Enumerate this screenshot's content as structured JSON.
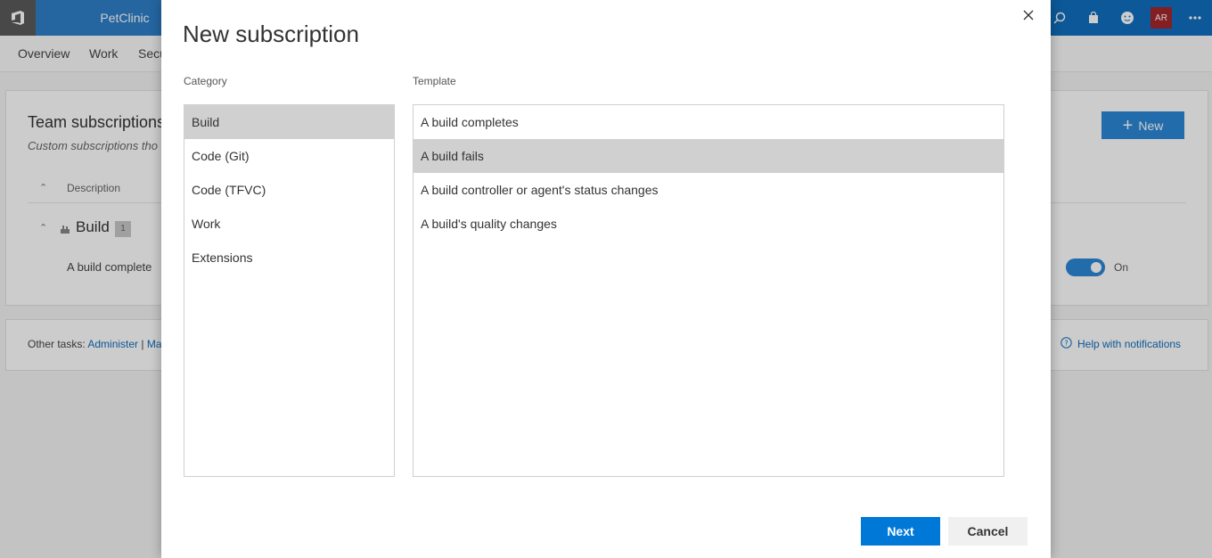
{
  "header": {
    "project": "PetClinic",
    "avatar_initials": "AR"
  },
  "subnav": {
    "items": [
      "Overview",
      "Work",
      "Secu"
    ]
  },
  "page": {
    "team_title": "Team subscriptions",
    "team_subtitle": "Custom subscriptions tho",
    "description_header": "Description",
    "group_name": "Build",
    "group_count": "1",
    "row_text": "A build complete",
    "new_button": "New",
    "toggle_label": "On",
    "other_tasks_label": "Other tasks:",
    "other_tasks_link1": "Administer",
    "other_tasks_sep": "|",
    "other_tasks_link2": "Ma",
    "help_link": "Help with notifications"
  },
  "dialog": {
    "title": "New subscription",
    "category_label": "Category",
    "template_label": "Template",
    "categories": [
      "Build",
      "Code (Git)",
      "Code (TFVC)",
      "Work",
      "Extensions"
    ],
    "templates": [
      "A build completes",
      "A build fails",
      "A build controller or agent's status changes",
      "A build's quality changes"
    ],
    "next_button": "Next",
    "cancel_button": "Cancel"
  },
  "colors": {
    "accent": "#0078d7",
    "topbar": "#106ebe",
    "selection": "#d0d0d0"
  }
}
